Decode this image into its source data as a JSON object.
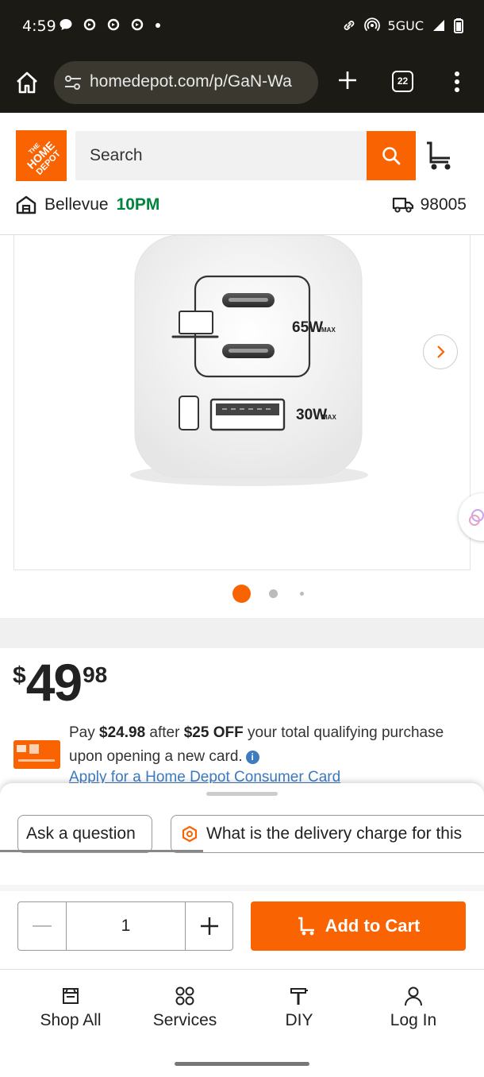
{
  "status_bar": {
    "time": "4:59",
    "network": "5GUC"
  },
  "browser": {
    "url": "homedepot.com/p/GaN-Wa",
    "tab_count": "22"
  },
  "header": {
    "search_placeholder": "Search",
    "store_name": "Bellevue",
    "store_hours": "10PM",
    "zip": "98005"
  },
  "product_image": {
    "port_label_top": "65W",
    "port_label_top_sub": "MAX",
    "port_label_bottom": "30W",
    "port_label_bottom_sub": "MAX",
    "carousel_dots": 3,
    "active_dot": 1
  },
  "price": {
    "currency": "$",
    "dollars": "49",
    "cents": "98"
  },
  "promo": {
    "pay_prefix": "Pay ",
    "pay_amount": "$24.98",
    "after": " after ",
    "off_amount": "$25 OFF",
    "rest": " your total qualifying purchase upon opening a new card.",
    "apply_link": "Apply for a Home Depot Consumer Card"
  },
  "sheet": {
    "chip_ask": "Ask a question",
    "chip_delivery": "What is the delivery charge for this"
  },
  "purchase": {
    "quantity": "1",
    "add_to_cart": "Add to Cart"
  },
  "bottom_nav": {
    "items": [
      {
        "label": "Shop All",
        "icon": "shop-all-icon"
      },
      {
        "label": "Services",
        "icon": "services-icon"
      },
      {
        "label": "DIY",
        "icon": "diy-icon"
      },
      {
        "label": "Log In",
        "icon": "user-icon"
      }
    ]
  },
  "colors": {
    "brand": "#f96302",
    "store_hours": "#00853e",
    "link": "#3e7bbf"
  }
}
